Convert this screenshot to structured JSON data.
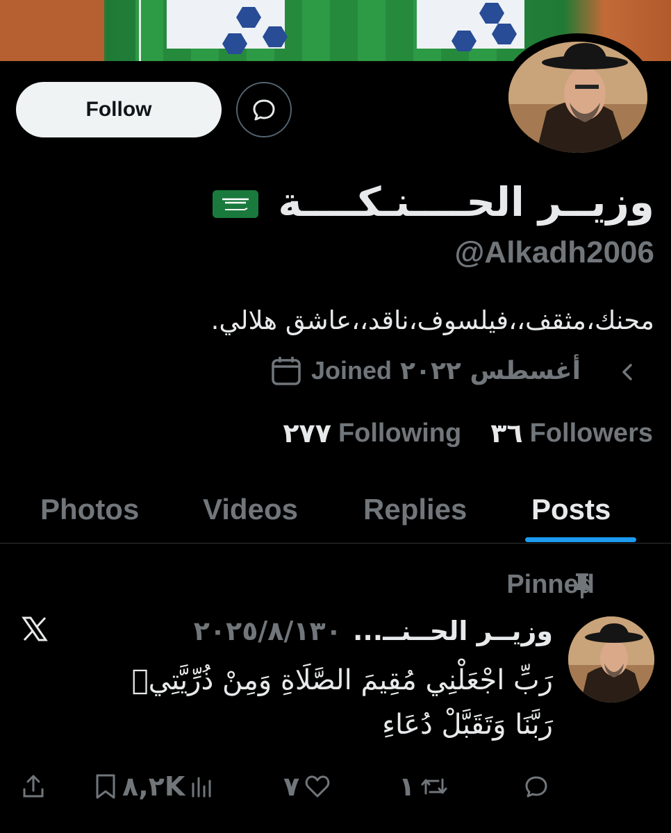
{
  "profile": {
    "display_name": "وزيــر الحــــنـكــــة",
    "handle": "@Alkadh2006",
    "bio": "محنك،مثقف،،فيلسوف،ناقد،،عاشق هلالي.",
    "joined_label": "Joined",
    "joined_date": "أغسطس ٢٠٢٢",
    "following_count": "٢٧٧",
    "following_label": "Following",
    "followers_count": "٣٦",
    "followers_label": "Followers",
    "follow_label": "Follow"
  },
  "tabs": [
    {
      "label": "Photos"
    },
    {
      "label": "Videos"
    },
    {
      "label": "Replies"
    },
    {
      "label": "Posts"
    }
  ],
  "post": {
    "pinned_label": "Pinned",
    "author": "وزيــر الحــنــ...",
    "date": "٢٠٢٥/٨/١٣٠",
    "line1": "رَبِّ اجْعَلْنِي مُقِيمَ الصَّلَاةِ وَمِنْ ذُرِّيَّتِيۚ",
    "line2": "رَبَّنَا وَتَقَبَّلْ دُعَاءِ",
    "views": "٨,٢K",
    "likes": "٧",
    "reposts": "١"
  },
  "colors": {
    "accent": "#1d9bf0",
    "muted": "#71767b",
    "text": "#e7e9ea",
    "background": "#000000"
  }
}
